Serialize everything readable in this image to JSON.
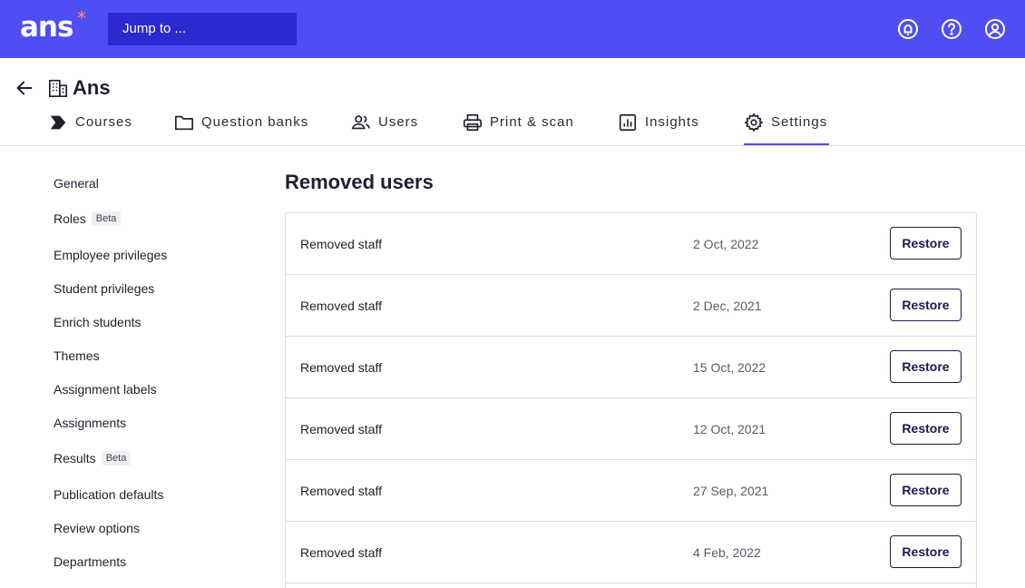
{
  "topbar": {
    "logo": "ans",
    "logo_mark": "*",
    "jump_label": "Jump to ...",
    "icons": [
      "notifications-icon",
      "help-icon",
      "user-account-icon"
    ]
  },
  "header": {
    "org_title": "Ans",
    "tabs": [
      {
        "label": "Courses",
        "icon": "courses-icon"
      },
      {
        "label": "Question banks",
        "icon": "folder-icon"
      },
      {
        "label": "Users",
        "icon": "users-icon"
      },
      {
        "label": "Print & scan",
        "icon": "printer-icon"
      },
      {
        "label": "Insights",
        "icon": "chart-icon"
      },
      {
        "label": "Settings",
        "icon": "gear-icon",
        "active": true
      }
    ]
  },
  "sidebar": {
    "items": [
      {
        "label": "General"
      },
      {
        "label": "Roles",
        "badge": "Beta"
      },
      {
        "label": "Employee privileges"
      },
      {
        "label": "Student privileges"
      },
      {
        "label": "Enrich students"
      },
      {
        "label": "Themes"
      },
      {
        "label": "Assignment labels"
      },
      {
        "label": "Assignments"
      },
      {
        "label": "Results",
        "badge": "Beta"
      },
      {
        "label": "Publication defaults"
      },
      {
        "label": "Review options"
      },
      {
        "label": "Departments"
      }
    ]
  },
  "main": {
    "title": "Removed users",
    "rows": [
      {
        "name": "Removed staff",
        "date": "2 Oct, 2022",
        "action": "Restore"
      },
      {
        "name": "Removed staff",
        "date": "2 Dec, 2021",
        "action": "Restore"
      },
      {
        "name": "Removed staff",
        "date": "15 Oct, 2022",
        "action": "Restore"
      },
      {
        "name": "Removed staff",
        "date": "12 Oct, 2021",
        "action": "Restore"
      },
      {
        "name": "Removed staff",
        "date": "27 Sep, 2021",
        "action": "Restore"
      },
      {
        "name": "Removed staff",
        "date": "4 Feb, 2022",
        "action": "Restore"
      }
    ]
  },
  "colors": {
    "brand": "#4f4ef2",
    "search_bg": "#2d29d0",
    "logo_accent": "#ff8e70",
    "button_border": "#1a1a4a"
  }
}
